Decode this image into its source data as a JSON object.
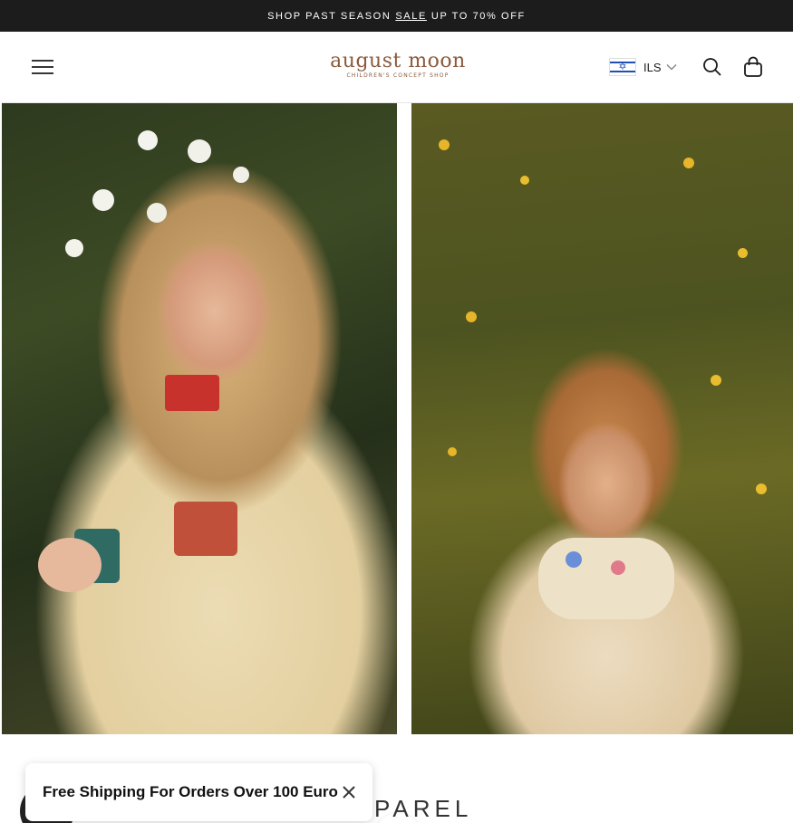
{
  "announcement": {
    "prefix": "SHOP PAST SEASON",
    "link": "SALE",
    "suffix": "UP TO 70% OFF"
  },
  "header": {
    "menu_icon": "hamburger-menu-icon",
    "logo": {
      "main": "august moon",
      "sub": "CHILDREN'S CONCEPT SHOP"
    },
    "currency": {
      "flag": "israel-flag-icon",
      "code": "ILS",
      "chevron": "chevron-down-icon"
    },
    "search_icon": "search-icon",
    "cart_icon": "shopping-bag-icon"
  },
  "hero": {
    "images": [
      "girl-with-daisies-photo",
      "girl-sitting-by-flowers-photo"
    ],
    "scroll_icon": "chevron-down-icon"
  },
  "section": {
    "heading_visible": "PAREL"
  },
  "shipping_bar": {
    "text": "Free Shipping For Orders Over 100 Euro",
    "close_icon": "close-icon"
  },
  "colors": {
    "announcement_bg": "#1c1c1c",
    "logo": "#8a5a3c",
    "flag_blue": "#1f4fb5"
  }
}
